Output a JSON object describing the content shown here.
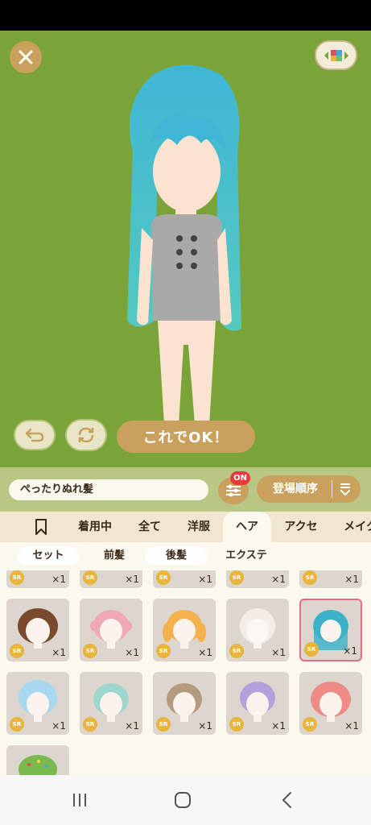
{
  "stage": {
    "background_color": "#7aa43a",
    "close_icon": "close-icon",
    "bg_toggle_icon": "color-grid-icon",
    "undo_icon": "undo-icon",
    "random_icon": "refresh-icon",
    "ok_label": "これでOK！"
  },
  "toolbar": {
    "item_name": "ぺったりぬれ髪",
    "filter_icon": "sliders-icon",
    "filter_badge": "ON",
    "sort_label": "登場順序",
    "sort_icon": "sort-order-icon"
  },
  "tabs": [
    {
      "label": "bookmark",
      "icon": "bookmark-icon"
    },
    {
      "label": "着用中"
    },
    {
      "label": "全て"
    },
    {
      "label": "洋服"
    },
    {
      "label": "ヘア"
    },
    {
      "label": "アクセ"
    },
    {
      "label": "メイク"
    }
  ],
  "subtabs": [
    "セット",
    "前髪",
    "後髪",
    "エクステ"
  ],
  "grid": {
    "rarity": "SR",
    "count": "×1",
    "hair_colors": [
      "#7a4a2e",
      "#f0a8b8",
      "#f5b14c",
      "#f2ede6",
      "#3cb2c8",
      "#a8d8f0",
      "#9cd6cc",
      "#b59a80",
      "#b6a0dc",
      "#ef8b86",
      "#7ab94c"
    ]
  }
}
